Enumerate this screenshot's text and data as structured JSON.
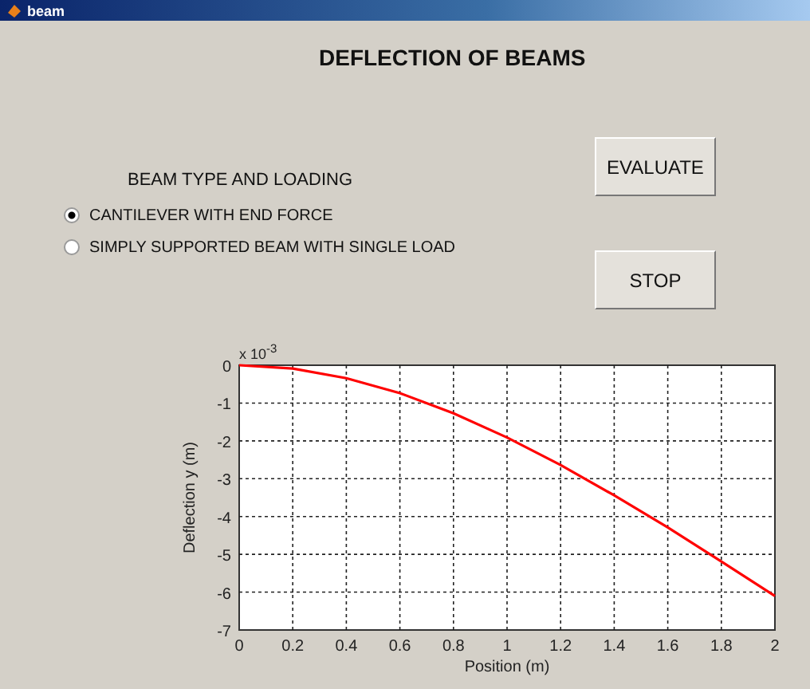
{
  "window": {
    "title": "beam"
  },
  "heading": "DEFLECTION OF BEAMS",
  "beam_type": {
    "label": "BEAM TYPE AND LOADING",
    "options": [
      {
        "label": "CANTILEVER WITH END FORCE",
        "selected": true
      },
      {
        "label": "SIMPLY SUPPORTED BEAM WITH SINGLE LOAD",
        "selected": false
      }
    ]
  },
  "buttons": [
    {
      "label": "EVALUATE"
    },
    {
      "label": "STOP"
    }
  ],
  "plot": {
    "y_multiplier": "x 10$^{-3}$",
    "chart_data": {
      "type": "line",
      "xlabel": "Position (m)",
      "ylabel": "Deflection y (m)",
      "x": [
        0,
        0.2,
        0.4,
        0.6,
        0.8,
        1,
        1.2,
        1.4,
        1.6,
        1.8,
        2
      ],
      "grid": true,
      "series": [
        {
          "color": "#ff0000",
          "values": [
            0,
            -0.09,
            -0.34,
            -0.74,
            -1.27,
            -1.91,
            -2.64,
            -3.44,
            -4.29,
            -5.19,
            -6.1
          ]
        }
      ],
      "xlim": [
        0,
        2
      ],
      "ylim": [
        -7,
        0
      ],
      "xticks": [
        0,
        0.2,
        0.4,
        0.6,
        0.8,
        1,
        1.2,
        1.4,
        1.6,
        1.8,
        2
      ],
      "yticks": [
        -7,
        -6,
        -5,
        -4,
        -3,
        -2,
        -1,
        0
      ]
    }
  }
}
